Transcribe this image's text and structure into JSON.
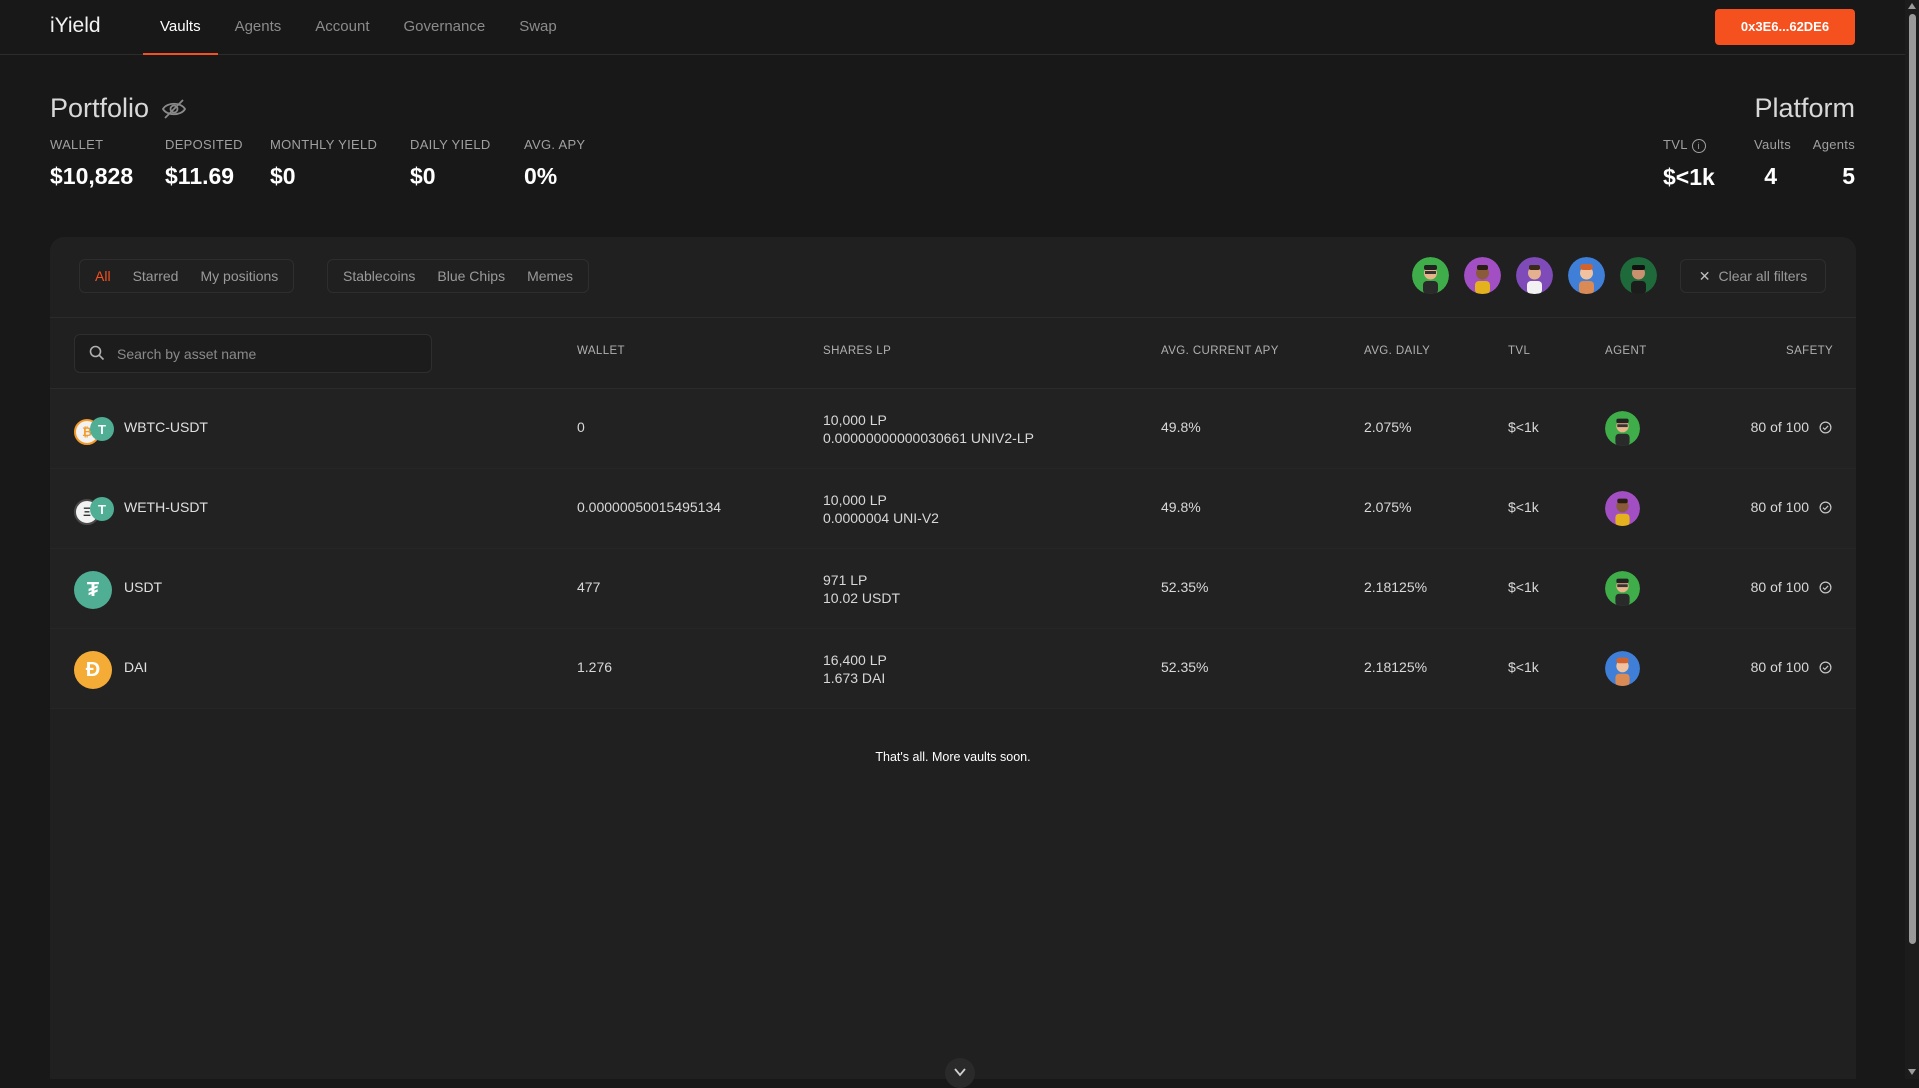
{
  "app": {
    "logo": "iYield"
  },
  "nav": {
    "tabs": [
      {
        "label": "Vaults",
        "active": true
      },
      {
        "label": "Agents"
      },
      {
        "label": "Account"
      },
      {
        "label": "Governance"
      },
      {
        "label": "Swap"
      }
    ],
    "wallet_button": "0x3E6...62DE6"
  },
  "portfolio": {
    "title": "Portfolio",
    "stats": [
      {
        "label": "WALLET",
        "value": "$10,828"
      },
      {
        "label": "DEPOSITED",
        "value": "$11.69"
      },
      {
        "label": "MONTHLY YIELD",
        "value": "$0"
      },
      {
        "label": "DAILY YIELD",
        "value": "$0"
      },
      {
        "label": "AVG. APY",
        "value": "0%"
      }
    ]
  },
  "platform": {
    "title": "Platform",
    "stats": [
      {
        "label": "TVL",
        "value": "$<1k"
      },
      {
        "label": "Vaults",
        "value": "4"
      },
      {
        "label": "Agents",
        "value": "5"
      }
    ]
  },
  "filters": {
    "group1": [
      "All",
      "Starred",
      "My positions"
    ],
    "group2": [
      "Stablecoins",
      "Blue Chips",
      "Memes"
    ],
    "active": "All",
    "agent_avatars": [
      "agent-avatar-green",
      "agent-avatar-yellow",
      "agent-avatar-purple",
      "agent-avatar-blue",
      "agent-avatar-darkgreen"
    ],
    "clear": "Clear all filters"
  },
  "search": {
    "placeholder": "Search by asset name"
  },
  "columns": [
    "WALLET",
    "SHARES LP",
    "AVG. CURRENT APY",
    "AVG. DAILY",
    "TVL",
    "AGENT",
    "SAFETY"
  ],
  "rows": [
    {
      "asset": "WBTC-USDT",
      "wallet": "0",
      "shares_line1": "10,000 LP",
      "shares_line2": "0.00000000000030661 UNIV2-LP",
      "apy": "49.8%",
      "daily": "2.075%",
      "tvl": "$<1k",
      "agent": "agent-avatar-green",
      "safety": "80 of 100"
    },
    {
      "asset": "WETH-USDT",
      "wallet": "0.00000050015495134",
      "shares_line1": "10,000 LP",
      "shares_line2": "0.0000004 UNI-V2",
      "apy": "49.8%",
      "daily": "2.075%",
      "tvl": "$<1k",
      "agent": "agent-avatar-purple",
      "safety": "80 of 100"
    },
    {
      "asset": "USDT",
      "wallet": "477",
      "shares_line1": "971 LP",
      "shares_line2": "10.02 USDT",
      "apy": "52.35%",
      "daily": "2.18125%",
      "tvl": "$<1k",
      "agent": "agent-avatar-green",
      "safety": "80 of 100"
    },
    {
      "asset": "DAI",
      "wallet": "1.276",
      "shares_line1": "16,400 LP",
      "shares_line2": "1.673 DAI",
      "apy": "52.35%",
      "daily": "2.18125%",
      "tvl": "$<1k",
      "agent": "agent-avatar-blue",
      "safety": "80 of 100"
    }
  ],
  "footer_note": "That's all. More vaults soon.",
  "colors": {
    "accent": "#f4511e",
    "background": "#181818",
    "panel": "#202020",
    "usdt": "#4fae94",
    "dai": "#f5ac37"
  }
}
